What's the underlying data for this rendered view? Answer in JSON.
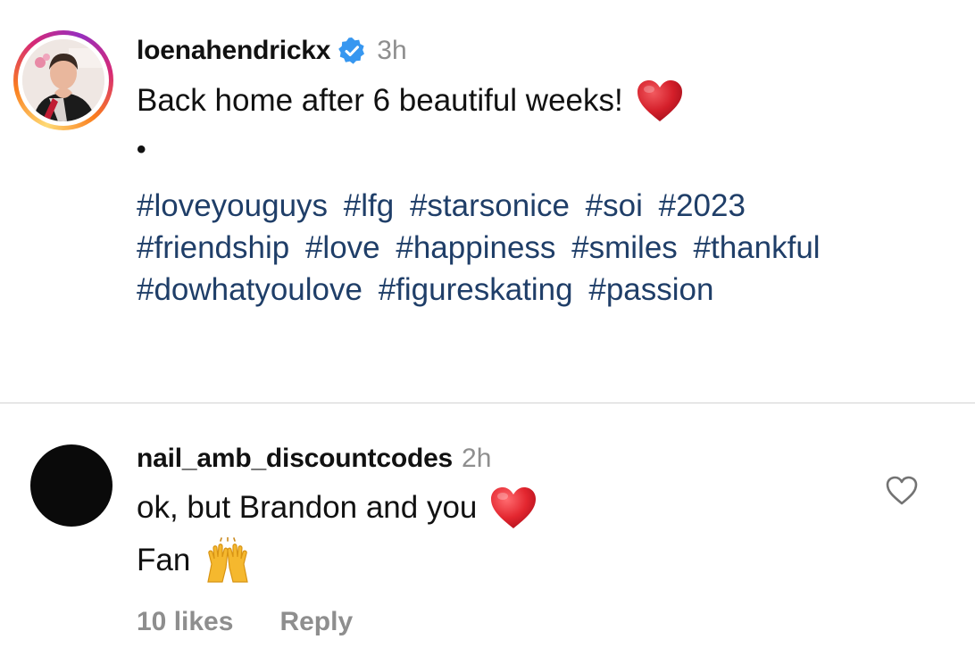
{
  "post": {
    "username": "loenahendrickx",
    "verified_icon": "verified-badge-icon",
    "timestamp": "3h",
    "caption": "Back home after 6 beautiful weeks!",
    "caption_emoji": "red-heart-icon",
    "separator": "•",
    "hashtags": [
      "#loveyouguys",
      "#lfg",
      "#starsonice",
      "#soi",
      "#2023",
      "#friendship",
      "#love",
      "#happiness",
      "#smiles",
      "#thankful",
      "#dowhatyoulove",
      "#figureskating",
      "#passion"
    ],
    "hashtag_color": "#1f3e68"
  },
  "comment": {
    "username": "nail_amb_discountcodes",
    "timestamp": "2h",
    "line1": "ok, but Brandon and you",
    "line1_emoji": "red-heart-icon",
    "line2": "Fan",
    "line2_emoji": "raising-hands-icon",
    "likes": "10 likes",
    "reply_label": "Reply",
    "like_icon": "heart-outline-icon"
  },
  "colors": {
    "text": "#111111",
    "muted": "#8e8e8e",
    "divider": "#d2d2d2",
    "verified": "#3797f0",
    "heart": "#e0202a"
  }
}
